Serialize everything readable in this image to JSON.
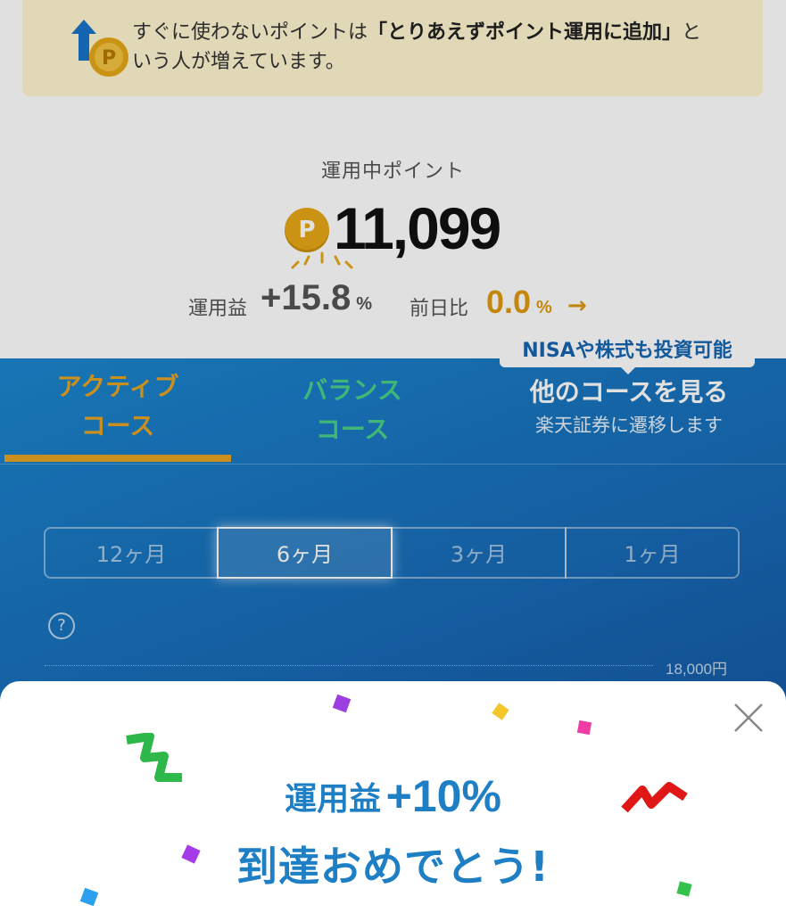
{
  "banner": {
    "text_before": "すぐに使わないポイントは",
    "text_bold": "「とりあえずポイント運用に追加」",
    "text_after": "という人が増えています。"
  },
  "summary": {
    "points_label": "運用中ポイント",
    "coin_symbol": "P",
    "points_value": "11,099",
    "gain_label": "運用益",
    "gain_value": "+15.8",
    "gain_unit": "%",
    "day_label": "前日比",
    "day_value": "0.0",
    "day_unit": "%",
    "day_arrow": "→"
  },
  "courses": {
    "tooltip": "NISAや株式も投資可能",
    "active_line1": "アクティブ",
    "active_line2": "コース",
    "balance_line1": "バランス",
    "balance_line2": "コース",
    "other_title": "他のコースを見る",
    "other_sub": "楽天証券に遷移します"
  },
  "periods": [
    "12ヶ月",
    "6ヶ月",
    "3ヶ月",
    "1ヶ月"
  ],
  "selected_period": "6ヶ月",
  "help_icon": "?",
  "chart": {
    "y_label": "18,000円"
  },
  "modal": {
    "line1_prefix": "運用益",
    "line1_value": "+10%",
    "line2": "到達おめでとう!"
  },
  "colors": {
    "accent_orange": "#e8a321",
    "accent_green": "#4bd08a",
    "panel_blue": "#1767b3",
    "modal_text": "#1e7fc4"
  }
}
